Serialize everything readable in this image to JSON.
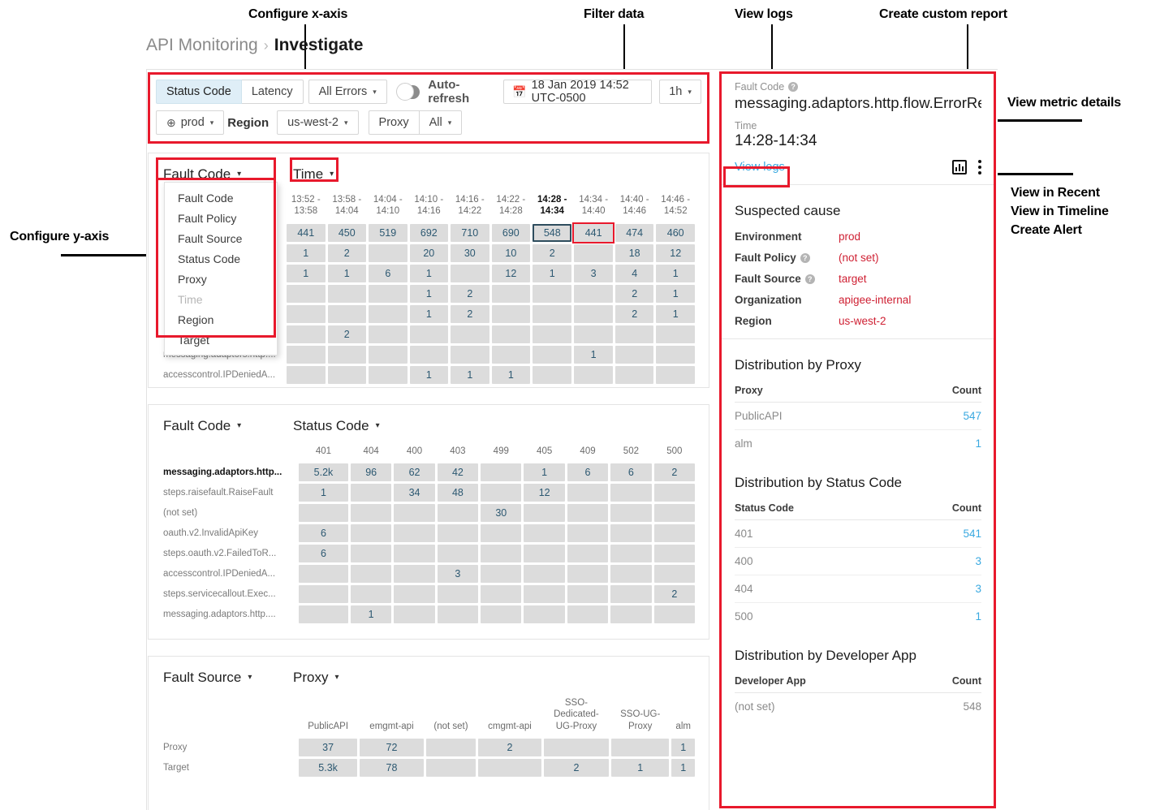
{
  "annotations": [
    {
      "id": "configure-x-axis",
      "text": "Configure x-axis"
    },
    {
      "id": "filter-data",
      "text": "Filter data"
    },
    {
      "id": "view-logs",
      "text": "View logs"
    },
    {
      "id": "create-custom-report",
      "text": "Create custom report"
    },
    {
      "id": "view-metric-details",
      "text": "View metric details"
    },
    {
      "id": "view-in-recent",
      "text": "View in Recent"
    },
    {
      "id": "view-in-timeline",
      "text": "View in Timeline"
    },
    {
      "id": "create-alert",
      "text": "Create Alert"
    },
    {
      "id": "configure-y-axis",
      "text": "Configure y-axis"
    }
  ],
  "breadcrumb": {
    "root": "API Monitoring",
    "separator": "›",
    "current": "Investigate"
  },
  "toolbar": {
    "status_code": "Status Code",
    "latency": "Latency",
    "all_errors": "All Errors",
    "auto_refresh": "Auto-refresh",
    "date": "18 Jan 2019 14:52 UTC-0500",
    "calendar_icon": "📅",
    "duration": "1h",
    "env": "prod",
    "globe_icon": "⊕",
    "region_label": "Region",
    "region_value": "us-west-2",
    "proxy_label": "Proxy",
    "proxy_value": "All",
    "caret": "▾"
  },
  "y_axis_dropdown": {
    "items": [
      {
        "label": "Fault Code",
        "disabled": false
      },
      {
        "label": "Fault Policy",
        "disabled": false
      },
      {
        "label": "Fault Source",
        "disabled": false
      },
      {
        "label": "Status Code",
        "disabled": false
      },
      {
        "label": "Proxy",
        "disabled": false
      },
      {
        "label": "Time",
        "disabled": true
      },
      {
        "label": "Region",
        "disabled": false
      },
      {
        "label": "Target",
        "disabled": false
      }
    ]
  },
  "chart_data": [
    {
      "type": "heatmap",
      "id": "grid-fault-code-by-time",
      "y_axis_label": "Fault Code",
      "x_axis_label": "Time",
      "categories": [
        "13:52 -\n13:58",
        "13:58 -\n14:04",
        "14:04 -\n14:10",
        "14:10 -\n14:16",
        "14:16 -\n14:22",
        "14:22 -\n14:28",
        "14:28 -\n14:34",
        "14:34 -\n14:40",
        "14:40 -\n14:46",
        "14:46 -\n14:52"
      ],
      "selected_category_index": 6,
      "highlighted_category_index": 7,
      "rows": [
        {
          "label": "",
          "hidden_label": true,
          "values": [
            441,
            450,
            519,
            692,
            710,
            690,
            548,
            441,
            474,
            460
          ],
          "levels": [
            2,
            2,
            2,
            3,
            4,
            3,
            2,
            2,
            2,
            2
          ]
        },
        {
          "label": "",
          "hidden_label": true,
          "values": [
            1,
            2,
            null,
            20,
            30,
            10,
            2,
            null,
            18,
            12
          ],
          "levels": [
            1,
            1,
            0,
            1,
            1,
            1,
            1,
            0,
            1,
            1
          ]
        },
        {
          "label": "",
          "hidden_label": true,
          "values": [
            1,
            1,
            6,
            1,
            null,
            12,
            1,
            3,
            4,
            1
          ],
          "levels": [
            1,
            1,
            1,
            1,
            0,
            1,
            1,
            1,
            1,
            1
          ]
        },
        {
          "label": "",
          "hidden_label": true,
          "values": [
            null,
            null,
            null,
            1,
            2,
            null,
            null,
            null,
            2,
            1
          ],
          "levels": [
            0,
            0,
            0,
            1,
            1,
            0,
            0,
            0,
            1,
            1
          ]
        },
        {
          "label": "",
          "hidden_label": true,
          "values": [
            null,
            null,
            null,
            1,
            2,
            null,
            null,
            null,
            2,
            1
          ],
          "levels": [
            0,
            0,
            0,
            1,
            1,
            0,
            0,
            0,
            1,
            1
          ]
        },
        {
          "label": "",
          "hidden_label": true,
          "values": [
            null,
            2,
            null,
            null,
            null,
            null,
            null,
            null,
            null,
            null
          ],
          "levels": [
            0,
            1,
            0,
            0,
            0,
            0,
            0,
            0,
            0,
            0
          ]
        },
        {
          "label": "messaging.adaptors.http....",
          "hidden_label": false,
          "values": [
            null,
            null,
            null,
            null,
            null,
            null,
            null,
            1,
            null,
            null
          ],
          "levels": [
            0,
            0,
            0,
            0,
            0,
            0,
            0,
            1,
            0,
            0
          ]
        },
        {
          "label": "accesscontrol.IPDeniedA...",
          "hidden_label": false,
          "values": [
            null,
            null,
            null,
            1,
            1,
            1,
            null,
            null,
            null,
            null
          ],
          "levels": [
            0,
            0,
            0,
            1,
            1,
            1,
            0,
            0,
            0,
            0
          ]
        }
      ]
    },
    {
      "type": "heatmap",
      "id": "grid-fault-code-by-status-code",
      "y_axis_label": "Fault Code",
      "x_axis_label": "Status Code",
      "categories": [
        "401",
        "404",
        "400",
        "403",
        "499",
        "405",
        "409",
        "502",
        "500"
      ],
      "rows": [
        {
          "label": "messaging.adaptors.http...",
          "bold": true,
          "values": [
            "5.2k",
            96,
            62,
            42,
            null,
            1,
            6,
            6,
            2
          ],
          "levels": [
            4,
            1,
            1,
            1,
            0,
            1,
            1,
            1,
            1
          ]
        },
        {
          "label": "steps.raisefault.RaiseFault",
          "values": [
            1,
            null,
            34,
            48,
            null,
            12,
            null,
            null,
            null
          ],
          "levels": [
            1,
            0,
            1,
            1,
            0,
            1,
            0,
            0,
            0
          ]
        },
        {
          "label": "(not set)",
          "values": [
            null,
            null,
            null,
            null,
            30,
            null,
            null,
            null,
            null
          ],
          "levels": [
            0,
            0,
            0,
            0,
            1,
            0,
            0,
            0,
            0
          ]
        },
        {
          "label": "oauth.v2.InvalidApiKey",
          "values": [
            6,
            null,
            null,
            null,
            null,
            null,
            null,
            null,
            null
          ],
          "levels": [
            1,
            0,
            0,
            0,
            0,
            0,
            0,
            0,
            0
          ]
        },
        {
          "label": "steps.oauth.v2.FailedToR...",
          "values": [
            6,
            null,
            null,
            null,
            null,
            null,
            null,
            null,
            null
          ],
          "levels": [
            1,
            0,
            0,
            0,
            0,
            0,
            0,
            0,
            0
          ]
        },
        {
          "label": "accesscontrol.IPDeniedA...",
          "values": [
            null,
            null,
            null,
            3,
            null,
            null,
            null,
            null,
            null
          ],
          "levels": [
            0,
            0,
            0,
            1,
            0,
            0,
            0,
            0,
            0
          ]
        },
        {
          "label": "steps.servicecallout.Exec...",
          "values": [
            null,
            null,
            null,
            null,
            null,
            null,
            null,
            null,
            2
          ],
          "levels": [
            0,
            0,
            0,
            0,
            0,
            0,
            0,
            0,
            1
          ]
        },
        {
          "label": "messaging.adaptors.http....",
          "values": [
            null,
            1,
            null,
            null,
            null,
            null,
            null,
            null,
            null
          ],
          "levels": [
            0,
            1,
            0,
            0,
            0,
            0,
            0,
            0,
            0
          ]
        }
      ]
    },
    {
      "type": "heatmap",
      "id": "grid-fault-source-by-proxy",
      "y_axis_label": "Fault Source",
      "x_axis_label": "Proxy",
      "categories": [
        "PublicAPI",
        "emgmt-api",
        "(not set)",
        "cmgmt-api",
        "SSO-\nDedicated-\nUG-Proxy",
        "SSO-UG-\nProxy",
        "alm"
      ],
      "rows": [
        {
          "label": "Proxy",
          "values": [
            37,
            72,
            null,
            2,
            null,
            null,
            1
          ],
          "levels": [
            1,
            1,
            0,
            1,
            0,
            0,
            1
          ]
        },
        {
          "label": "Target",
          "values": [
            "5.3k",
            78,
            null,
            null,
            2,
            1,
            1
          ],
          "levels": [
            4,
            1,
            0,
            0,
            1,
            1,
            1
          ]
        }
      ]
    }
  ],
  "detail": {
    "fault_code_label": "Fault Code",
    "fault_code_value": "messaging.adaptors.http.flow.ErrorRe...",
    "time_label": "Time",
    "time_value": "14:28-14:34",
    "view_logs": "View logs",
    "suspected_cause_title": "Suspected cause",
    "suspected_cause": [
      {
        "key": "Environment",
        "value": "prod",
        "help": false
      },
      {
        "key": "Fault Policy",
        "value": "(not set)",
        "help": true
      },
      {
        "key": "Fault Source",
        "value": "target",
        "help": true
      },
      {
        "key": "Organization",
        "value": "apigee-internal",
        "help": false
      },
      {
        "key": "Region",
        "value": "us-west-2",
        "help": false
      }
    ],
    "dist_proxy": {
      "title": "Distribution by Proxy",
      "col_key": "Proxy",
      "col_count": "Count",
      "rows": [
        {
          "name": "PublicAPI",
          "count": "547",
          "link": true
        },
        {
          "name": "alm",
          "count": "1",
          "link": true
        }
      ]
    },
    "dist_status": {
      "title": "Distribution by Status Code",
      "col_key": "Status Code",
      "col_count": "Count",
      "rows": [
        {
          "name": "401",
          "count": "541",
          "link": true
        },
        {
          "name": "400",
          "count": "3",
          "link": true
        },
        {
          "name": "404",
          "count": "3",
          "link": true
        },
        {
          "name": "500",
          "count": "1",
          "link": true
        }
      ]
    },
    "dist_app": {
      "title": "Distribution by Developer App",
      "col_key": "Developer App",
      "col_count": "Count",
      "rows": [
        {
          "name": "(not set)",
          "count": "548",
          "link": false
        }
      ]
    }
  },
  "colors": {
    "highlight_red": "#e8192c",
    "accent_blue": "#3aa9e0",
    "value_red": "#cf2033",
    "heat_max": "#0e9ad4",
    "heat_empty": "#dcdcdc"
  }
}
